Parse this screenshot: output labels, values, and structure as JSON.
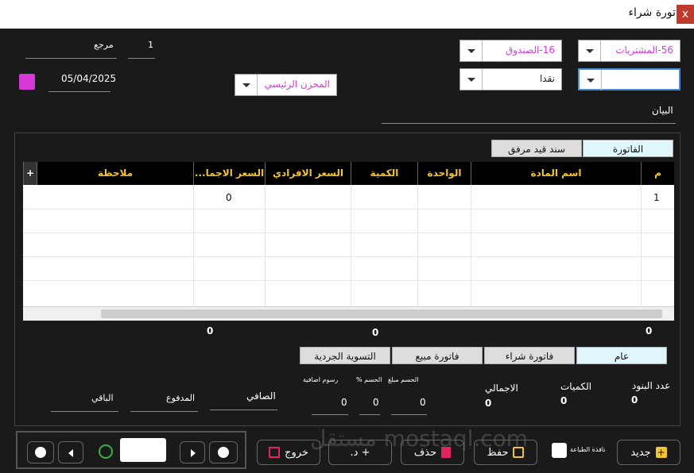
{
  "window": {
    "title": "فاتورة شراء",
    "close": "x"
  },
  "header": {
    "account": "56-المشتريات",
    "cashbox": "16-الصندوق",
    "payment": "نقدا",
    "store": "المخزن الرئيسي",
    "ref_label": "مرجع",
    "ref_value": "1",
    "date": "05/04/2025",
    "statement_label": "البيان"
  },
  "tabs_top": [
    "الفاتورة",
    "سند قيد مرفق"
  ],
  "grid": {
    "columns": [
      "م",
      "اسم المادة",
      "الواحدة",
      "الكمية",
      "السعر الافرادي",
      "السعر الاجما...",
      "ملاحظة"
    ],
    "rows": [
      {
        "num": "1",
        "total": "0"
      }
    ],
    "add": "+"
  },
  "totals": {
    "first": "0",
    "qty": "0",
    "total": "0"
  },
  "tabs_bottom": [
    "عام",
    "فاتورة شراء",
    "فاتورة مبيع",
    "التسوية الجردية"
  ],
  "summary": {
    "items_label": "عدد البنود",
    "items_value": "0",
    "qty_label": "الكميات",
    "qty_value": "0",
    "total_label": "الاجمالي",
    "total_value": "0",
    "discount_amount_label": "الحسم مبلغ",
    "discount_amount_value": "0",
    "discount_pct_label": "الحسم %",
    "discount_pct_value": "0",
    "fees_label": "رسوم اضافية",
    "fees_value": "0",
    "net_label": "الصافي",
    "paid_label": "المدفوع",
    "rest_label": "الباقي"
  },
  "buttons": {
    "new": "جديد",
    "print_window": "نافذة الطباعة",
    "save": "حفظ",
    "delete": "حذف",
    "extra": "+ د.",
    "exit": "خروج"
  },
  "watermark": "مستقل mostaql.com",
  "colors": {
    "accent_pink": "#d63ad6",
    "header_yellow": "#f4c430"
  }
}
